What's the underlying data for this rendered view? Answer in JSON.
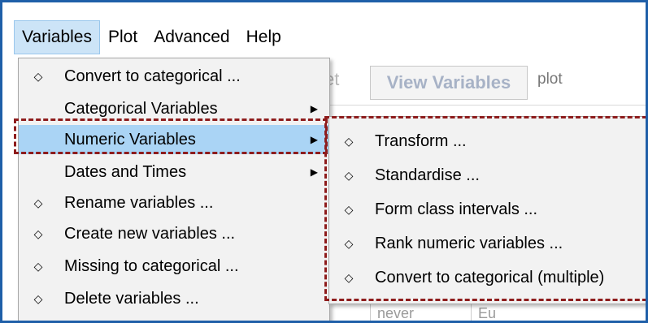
{
  "menubar": {
    "items": [
      {
        "label": "Variables"
      },
      {
        "label": "Plot"
      },
      {
        "label": "Advanced"
      },
      {
        "label": "Help"
      }
    ]
  },
  "background": {
    "partial_button": "et",
    "view_variables_button": "View Variables",
    "plot_tab": "plot",
    "cells": [
      "never",
      "Eu"
    ]
  },
  "variables_menu": {
    "items": [
      {
        "label": "Convert to categorical ...",
        "bullet": "◇"
      },
      {
        "label": "Categorical Variables",
        "arrow": "▶"
      },
      {
        "label": "Numeric Variables",
        "arrow": "▶"
      },
      {
        "label": "Dates and Times",
        "arrow": "▶"
      },
      {
        "label": "Rename variables ...",
        "bullet": "◇"
      },
      {
        "label": "Create new variables ...",
        "bullet": "◇"
      },
      {
        "label": "Missing to categorical ...",
        "bullet": "◇"
      },
      {
        "label": "Delete variables ...",
        "bullet": "◇"
      }
    ]
  },
  "numeric_submenu": {
    "items": [
      {
        "label": "Transform ...",
        "bullet": "◇"
      },
      {
        "label": "Standardise ...",
        "bullet": "◇"
      },
      {
        "label": "Form class intervals ...",
        "bullet": "◇"
      },
      {
        "label": "Rank numeric variables ...",
        "bullet": "◇"
      },
      {
        "label": "Convert to categorical (multiple)",
        "bullet": "◇"
      }
    ]
  },
  "colors": {
    "highlight": "#aad4f5",
    "annotation": "#8e1c1c",
    "frame": "#1f5fa8"
  }
}
